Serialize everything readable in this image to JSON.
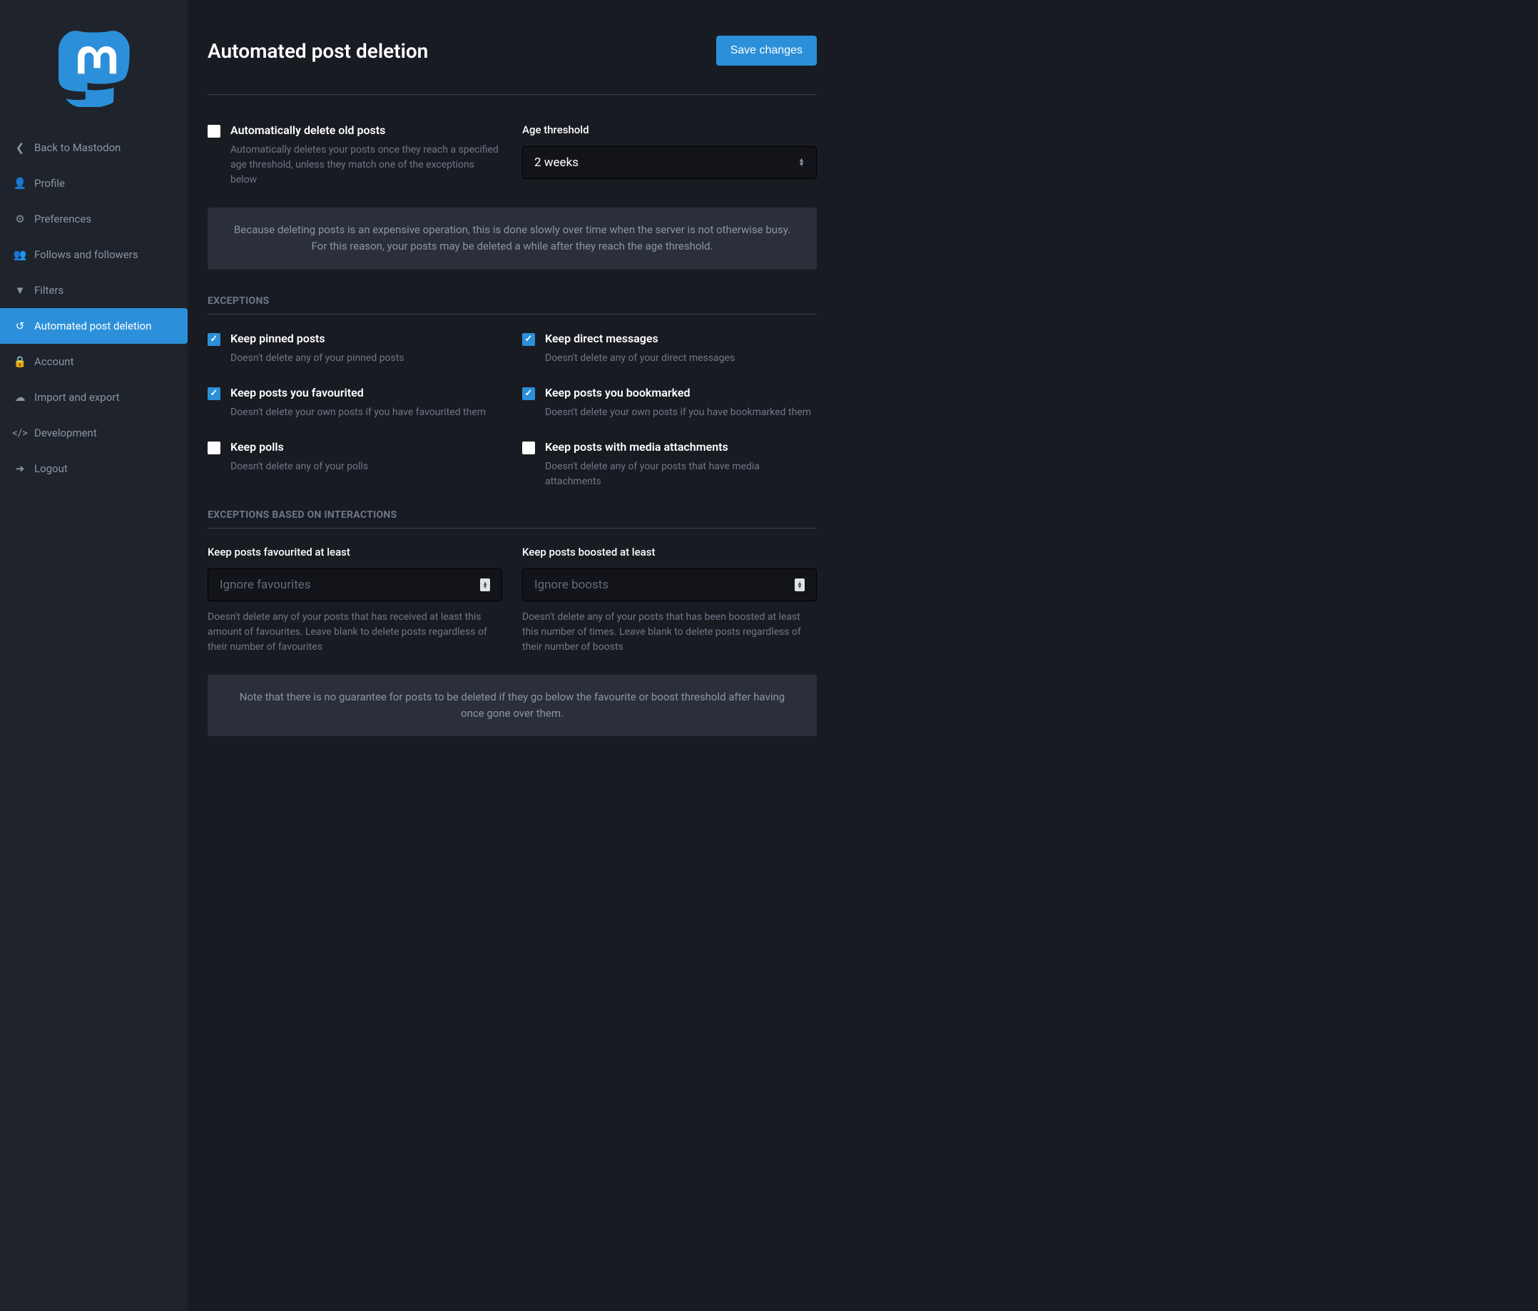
{
  "sidebar": {
    "items": [
      {
        "label": "Back to Mastodon",
        "icon": "chevron-left"
      },
      {
        "label": "Profile",
        "icon": "user"
      },
      {
        "label": "Preferences",
        "icon": "gear"
      },
      {
        "label": "Follows and followers",
        "icon": "users"
      },
      {
        "label": "Filters",
        "icon": "filter"
      },
      {
        "label": "Automated post deletion",
        "icon": "history",
        "active": true
      },
      {
        "label": "Account",
        "icon": "lock"
      },
      {
        "label": "Import and export",
        "icon": "cloud"
      },
      {
        "label": "Development",
        "icon": "code"
      },
      {
        "label": "Logout",
        "icon": "signout"
      }
    ]
  },
  "header": {
    "title": "Automated post deletion",
    "save_label": "Save changes"
  },
  "auto_delete": {
    "label": "Automatically delete old posts",
    "hint": "Automatically deletes your posts once they reach a specified age threshold, unless they match one of the exceptions below",
    "checked": false
  },
  "age_threshold": {
    "label": "Age threshold",
    "value": "2 weeks"
  },
  "info1": "Because deleting posts is an expensive operation, this is done slowly over time when the server is not otherwise busy. For this reason, your posts may be deleted a while after they reach the age threshold.",
  "exceptions": {
    "title": "EXCEPTIONS",
    "items": [
      {
        "label": "Keep pinned posts",
        "hint": "Doesn't delete any of your pinned posts",
        "checked": true
      },
      {
        "label": "Keep direct messages",
        "hint": "Doesn't delete any of your direct messages",
        "checked": true
      },
      {
        "label": "Keep posts you favourited",
        "hint": "Doesn't delete your own posts if you have favourited them",
        "checked": true
      },
      {
        "label": "Keep posts you bookmarked",
        "hint": "Doesn't delete your own posts if you have bookmarked them",
        "checked": true
      },
      {
        "label": "Keep polls",
        "hint": "Doesn't delete any of your polls",
        "checked": false
      },
      {
        "label": "Keep posts with media attachments",
        "hint": "Doesn't delete any of your posts that have media attachments",
        "checked": false
      }
    ]
  },
  "interactions": {
    "title": "EXCEPTIONS BASED ON INTERACTIONS",
    "fav": {
      "label": "Keep posts favourited at least",
      "placeholder": "Ignore favourites",
      "hint": "Doesn't delete any of your posts that has received at least this amount of favourites. Leave blank to delete posts regardless of their number of favourites"
    },
    "boost": {
      "label": "Keep posts boosted at least",
      "placeholder": "Ignore boosts",
      "hint": "Doesn't delete any of your posts that has been boosted at least this number of times. Leave blank to delete posts regardless of their number of boosts"
    }
  },
  "info2": "Note that there is no guarantee for posts to be deleted if they go below the favourite or boost threshold after having once gone over them."
}
